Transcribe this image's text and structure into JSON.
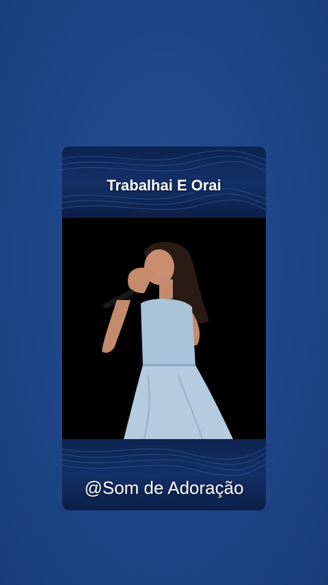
{
  "card": {
    "title": "Trabalhai E Orai",
    "handle": "@Som de Adoração"
  },
  "colors": {
    "background": "#1f4789",
    "band": "#143066",
    "video_bg": "#000000"
  }
}
